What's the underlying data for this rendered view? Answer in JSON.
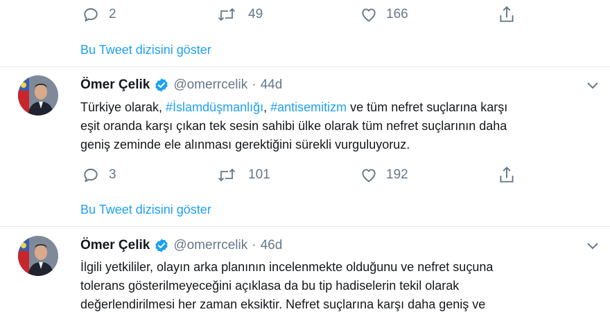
{
  "tweets": [
    {
      "actions": {
        "reply_count": "2",
        "retweet_count": "49",
        "like_count": "166"
      },
      "thread_link": "Bu Tweet dizisini göster"
    },
    {
      "author": {
        "name": "Ömer Çelik",
        "handle": "@omerrcelik",
        "separator": "·",
        "time": "44d"
      },
      "text": {
        "line1_pre": "Türkiye olarak, ",
        "hashtag1": "#İslamdüşmanlığı",
        "comma": ", ",
        "hashtag2": "#antisemitizm",
        "line1_post": " ve tüm nefret suçlarına karşı",
        "line2": "eşit oranda karşı çıkan tek sesin sahibi ülke olarak tüm nefret suçlarının daha",
        "line3": "geniş zeminde ele alınması gerektiğini sürekli vurguluyoruz."
      },
      "actions": {
        "reply_count": "3",
        "retweet_count": "101",
        "like_count": "192"
      },
      "thread_link": "Bu Tweet dizisini göster"
    },
    {
      "author": {
        "name": "Ömer Çelik",
        "handle": "@omerrcelik",
        "separator": "·",
        "time": "46d"
      },
      "text": {
        "line1": "İlgili yetkililer, olayın arka planının incelenmekte olduğunu ve nefret suçuna",
        "line2": "tolerans gösterilmeyeceğini açıklasa da bu tip hadiselerin tekil olarak",
        "line3": "değerlendirilmesi her zaman eksiktir. Nefret suçlarına karşı daha geniş ve"
      }
    }
  ],
  "colors": {
    "accent": "#1da1f2",
    "muted": "#657786",
    "text": "#14171a",
    "divider": "#e6ecf0"
  }
}
